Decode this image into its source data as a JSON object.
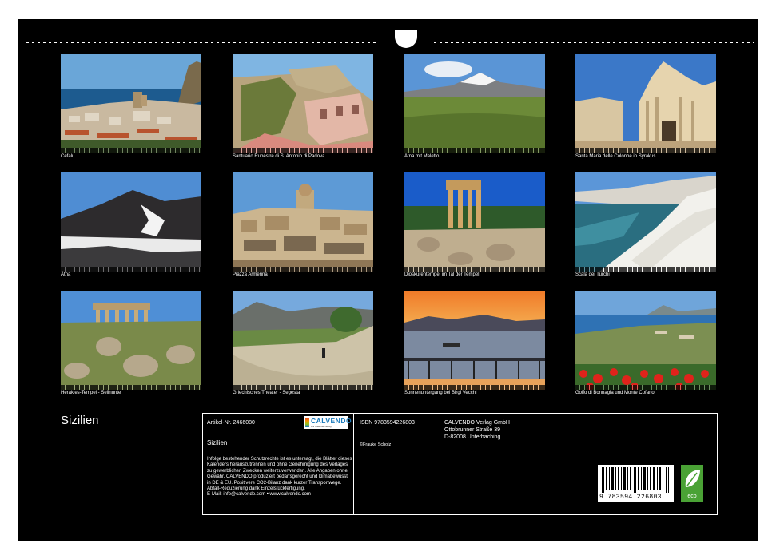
{
  "page": {
    "title": "Sizilien",
    "background": "#000000"
  },
  "photos": [
    {
      "caption": "Cefalu",
      "scene": "cefalu"
    },
    {
      "caption": "Santuario Rupestre di S. Antonio di Padova",
      "scene": "santuario"
    },
    {
      "caption": "Ätna mit Maletto",
      "scene": "etna-maletto"
    },
    {
      "caption": "Santa Maria delle Colonne in Syrakus",
      "scene": "syrakus"
    },
    {
      "caption": "Ätna",
      "scene": "etna"
    },
    {
      "caption": "Piazza Armerina",
      "scene": "piazza"
    },
    {
      "caption": "Dioskurentempel im Tal der Tempel",
      "scene": "dioskuren"
    },
    {
      "caption": "Scala dei Turchi",
      "scene": "scala"
    },
    {
      "caption": "Herakles-Tempel - Selinunte",
      "scene": "selinunte"
    },
    {
      "caption": "Griechisches Theater - Segesta",
      "scene": "segesta"
    },
    {
      "caption": "Sonnenuntergang bei Birgi Vecchi",
      "scene": "sunset"
    },
    {
      "caption": "Golfo di Bonnagia und Monte Cofano",
      "scene": "golfo"
    }
  ],
  "info": {
    "article": "Artikel-Nr. 2466080",
    "name": "Sizilien",
    "legal": "Infolge bestehender Schutzrechte ist es untersagt, die Blätter dieses Kalenders herauszutrennen und ohne Genehmigung des Verlages zu gewerblichen Zwecken weiterzuverwenden. Alle Angaben ohne Gewähr. CALVENDO produziert bedarfsgerecht und klimabewusst in DE & EU. Positivere CO2-Bilanz dank kurzer Transportwege. Abfall-Reduzierung dank Einzelstückfertigung.",
    "email": "E-Mail: info@calvendo.com • www.calvendo.com",
    "isbn": "ISBN 9783594226803",
    "copyright": "©Frauke Scholz",
    "publisher": [
      "CALVENDO Verlag GmbH",
      "Ottobrunner Straße 39",
      "D-82008 Unterhaching"
    ],
    "logo_text": "CALVENDO",
    "logo_sub": "Wir Kalenderverlag",
    "barcode_number": "9 783594 226803",
    "eco_label": "eco"
  },
  "colors": {
    "logo_blue": "#1a7bbd",
    "eco_green": "#4aa235"
  }
}
